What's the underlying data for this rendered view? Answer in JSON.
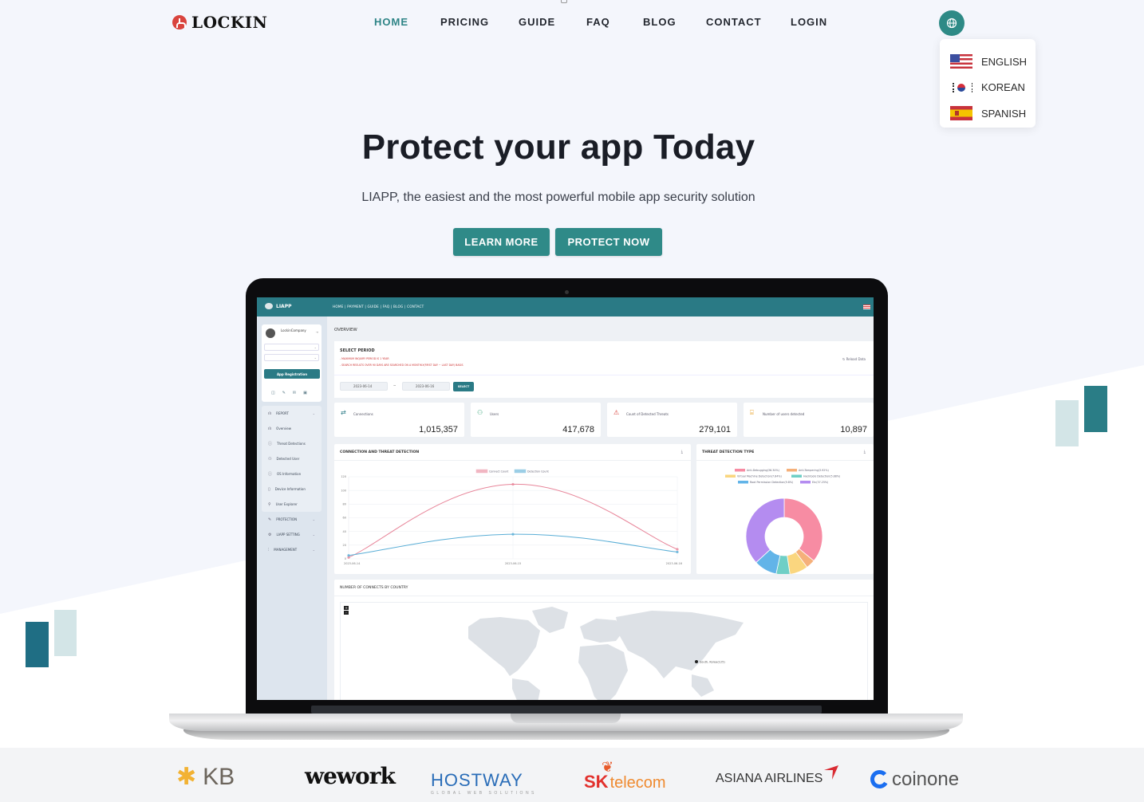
{
  "header": {
    "brand": "LOCKIN",
    "nav": [
      {
        "label": "HOME",
        "active": true
      },
      {
        "label": "PRICING",
        "active": false
      },
      {
        "label": "GUIDE",
        "active": false
      },
      {
        "label": "FAQ",
        "active": false
      },
      {
        "label": "BLOG",
        "active": false
      },
      {
        "label": "CONTACT",
        "active": false
      },
      {
        "label": "LOGIN",
        "active": false
      }
    ],
    "language_menu": {
      "icon": "globe-icon",
      "items": [
        {
          "label": "ENGLISH",
          "flag": "us-flag-icon"
        },
        {
          "label": "KOREAN",
          "flag": "kr-flag-icon"
        },
        {
          "label": "SPANISH",
          "flag": "es-flag-icon"
        }
      ]
    }
  },
  "hero": {
    "title": "Protect your app Today",
    "subtitle": "LIAPP, the easiest and the most powerful mobile app security solution",
    "buttons": [
      "LEARN MORE",
      "PROTECT NOW"
    ],
    "accent": "#2f8a88"
  },
  "dashboard": {
    "brand": "LIAPP",
    "topnav": "HOME  |  PAYMENT  |  GUIDE  |  FAQ  |  BLOG  |  CONTACT",
    "user": "LockinCompany",
    "register_button": "App Registration",
    "sidebar": [
      {
        "label": "REPORT",
        "icon": "bar-chart-icon",
        "expandable": true
      },
      {
        "label": "Overview",
        "icon": "bar-chart-icon"
      },
      {
        "label": "Threat Detections",
        "icon": "alert-circle-icon"
      },
      {
        "label": "Detected User",
        "icon": "users-icon"
      },
      {
        "label": "OS Information",
        "icon": "info-icon"
      },
      {
        "label": "Device Information",
        "icon": "device-icon"
      },
      {
        "label": "User Explorer",
        "icon": "search-icon"
      },
      {
        "label": "PROTECTION",
        "icon": "pen-icon",
        "expandable": true
      },
      {
        "label": "LIAPP SETTING",
        "icon": "gear-icon",
        "expandable": true
      },
      {
        "label": "MANAGEMENT",
        "icon": "sliders-icon",
        "expandable": true
      }
    ],
    "page_title": "OVERVIEW",
    "period": {
      "title": "SELECT PERIOD",
      "notes": [
        "- MAXIMUM INQUIRY PERIOD IS 1 YEAR",
        "- SEARCH RESULTS OVER 90 DAYS ARE SEARCHED ON A MONTHLY(FIRST DAY ~ LAST DAY) BASIS"
      ],
      "reload": "Reload Data",
      "start": "2023-06-14",
      "separator": "~",
      "end": "2023-06-16",
      "select_button": "SELECT"
    },
    "stats": [
      {
        "label": "Connections",
        "value": "1,015,357",
        "icon": "swap-icon",
        "color": "#2a7a85"
      },
      {
        "label": "Users",
        "value": "417,678",
        "icon": "users-icon",
        "color": "#3aa57a"
      },
      {
        "label": "Count of Detected Threats",
        "value": "279,101",
        "icon": "warning-icon",
        "color": "#d9443e"
      },
      {
        "label": "Number of users detected",
        "value": "10,897",
        "icon": "user-alert-icon",
        "color": "#e8a530"
      }
    ],
    "map": {
      "title": "NUMBER OF CONNECTS BY COUNTRY",
      "zoom_in": "+",
      "zoom_out": "-",
      "marker_label": "South, Korea(125)"
    }
  },
  "chart_data": [
    {
      "type": "line",
      "title": "CONNECTION AND THREAT DETECTION",
      "x": [
        "2023-06-14",
        "2023-06-15",
        "2023-06-16"
      ],
      "series": [
        {
          "name": "Connect Count",
          "values": [
            2,
            109,
            14
          ],
          "color": "#e8869a"
        },
        {
          "name": "Detection Count",
          "values": [
            5,
            36,
            10
          ],
          "color": "#5aaed6"
        }
      ],
      "yticks": [
        0,
        20,
        40,
        60,
        80,
        100,
        120
      ],
      "ylim": [
        0,
        120
      ],
      "legend": "top-center",
      "grid": true
    },
    {
      "type": "pie",
      "title": "THREAT DETECTION TYPE",
      "donut": true,
      "labels": [
        "Anti-Debugging(36.30%)",
        "Anti-Tampering(3.92%)",
        "Virtual Machine Detection(7.84%)",
        "Hacktools Detection(5.88%)",
        "Root Permission Detection(9.8%)",
        "Etc(37.25%)"
      ],
      "values": [
        36.3,
        3.92,
        7.84,
        5.88,
        9.8,
        37.25
      ],
      "colors": [
        "#f78ca3",
        "#f5b07a",
        "#fad67f",
        "#6fcfc6",
        "#62b4e8",
        "#b48cf0"
      ],
      "legend": "top-center"
    }
  ],
  "clients": [
    "KB",
    "wework",
    "HOSTWAY",
    "GLOBAL WEB SOLUTIONS",
    "SK",
    "telecom",
    "ASIANA AIRLINES",
    "coinone"
  ]
}
